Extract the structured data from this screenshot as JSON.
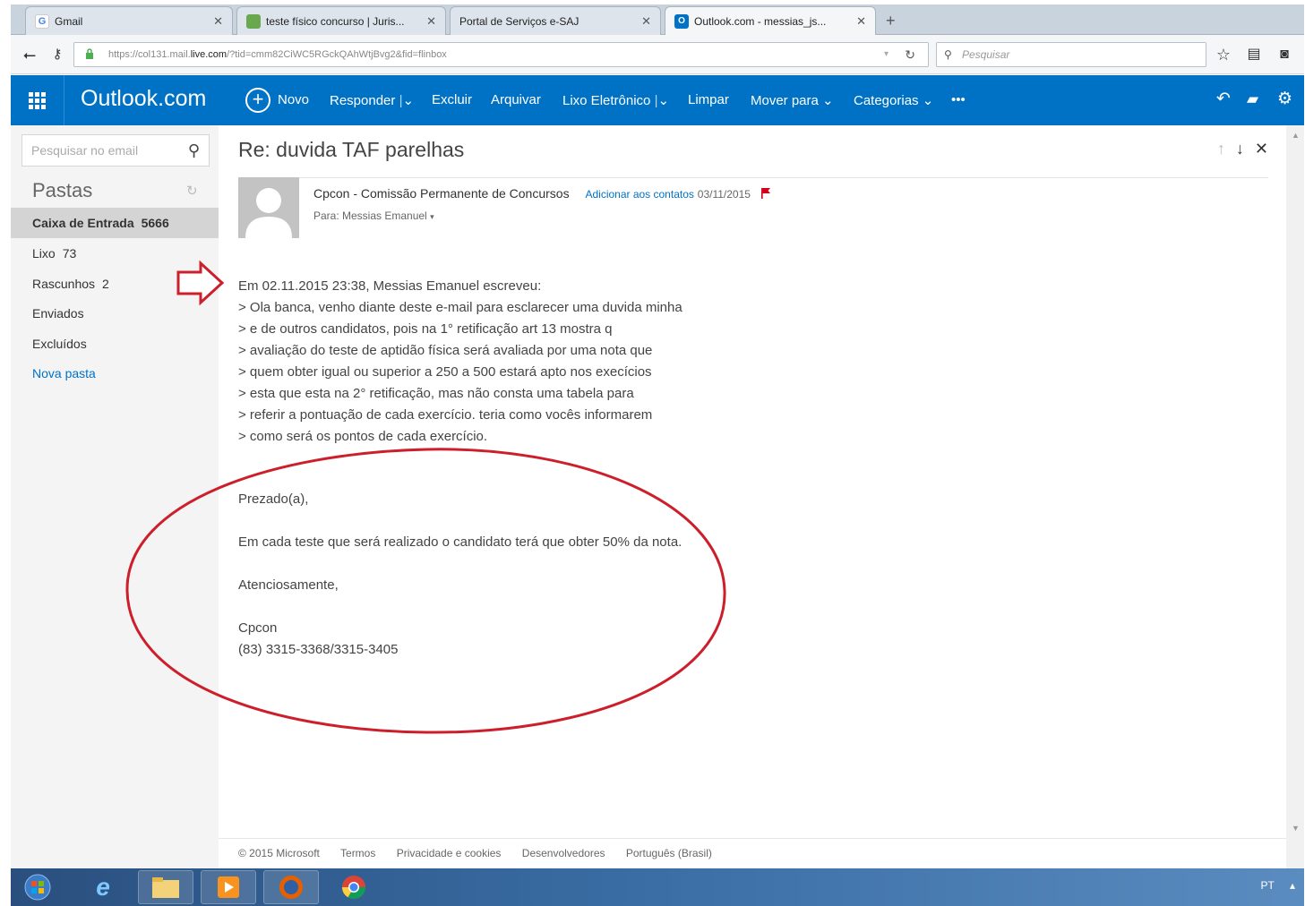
{
  "browser": {
    "tabs": [
      {
        "label": "Gmail",
        "icon": "gmail-icon",
        "active": false
      },
      {
        "label": "teste físico concurso | Juris...",
        "icon": "jurisway-icon",
        "active": false
      },
      {
        "label": "Portal de Serviços e-SAJ",
        "icon": "",
        "active": false
      },
      {
        "label": "Outlook.com - messias_js...",
        "icon": "outlook-icon",
        "active": true
      }
    ],
    "url_prefix": "https://col131.mail.",
    "url_domain": "live.com",
    "url_suffix": "/?tid=cmm82CiWC5RGckQAhWtjBvg2&fid=flinbox",
    "search_placeholder": "Pesquisar"
  },
  "outlook": {
    "brand": "Outlook.com",
    "commands": {
      "new": "Novo",
      "reply": "Responder",
      "delete": "Excluir",
      "archive": "Arquivar",
      "junk": "Lixo Eletrônico",
      "sweep": "Limpar",
      "move": "Mover para",
      "categories": "Categorias",
      "more": "•••"
    }
  },
  "sidebar": {
    "search_placeholder": "Pesquisar no email",
    "folders_title": "Pastas",
    "folders": [
      {
        "label": "Caixa de Entrada",
        "count": "5666"
      },
      {
        "label": "Lixo",
        "count": "73"
      },
      {
        "label": "Rascunhos",
        "count": "2"
      },
      {
        "label": "Enviados",
        "count": ""
      },
      {
        "label": "Excluídos",
        "count": ""
      }
    ],
    "new_folder": "Nova pasta"
  },
  "message": {
    "subject": "Re: duvida TAF parelhas",
    "sender": "Cpcon - Comissão Permanente de Concursos",
    "add_contact": "Adicionar aos contatos",
    "date": "03/11/2015",
    "to": "Para: Messias Emanuel",
    "quote_intro": "Em 02.11.2015 23:38, Messias Emanuel escreveu:",
    "quote_lines": [
      "> Ola banca, venho diante deste e-mail para esclarecer uma duvida minha",
      "> e de outros candidatos, pois na 1° retificação art 13 mostra q",
      "> avaliação do teste de aptidão física será avaliada por uma nota que",
      "> quem obter igual ou superior a 250 a 500 estará apto nos execícios",
      "> esta que esta na 2° retificação, mas não consta uma tabela para",
      "> referir a pontuação de cada exercício. teria como vocês informarem",
      "> como será os pontos de cada exercício."
    ],
    "greeting": "Prezado(a),",
    "reply_text": "Em cada teste que será realizado o candidato terá que obter 50% da nota.",
    "closing": "Atenciosamente,",
    "signature_name": "Cpcon",
    "signature_phone": "(83) 3315-3368/3315-3405"
  },
  "footer": {
    "links": [
      "© 2015 Microsoft",
      "Termos",
      "Privacidade e cookies",
      "Desenvolvedores",
      "Português (Brasil)"
    ]
  },
  "taskbar": {
    "language": "PT"
  },
  "colors": {
    "outlook_blue": "#0072c6",
    "annotation_red": "#cc1f2b"
  }
}
